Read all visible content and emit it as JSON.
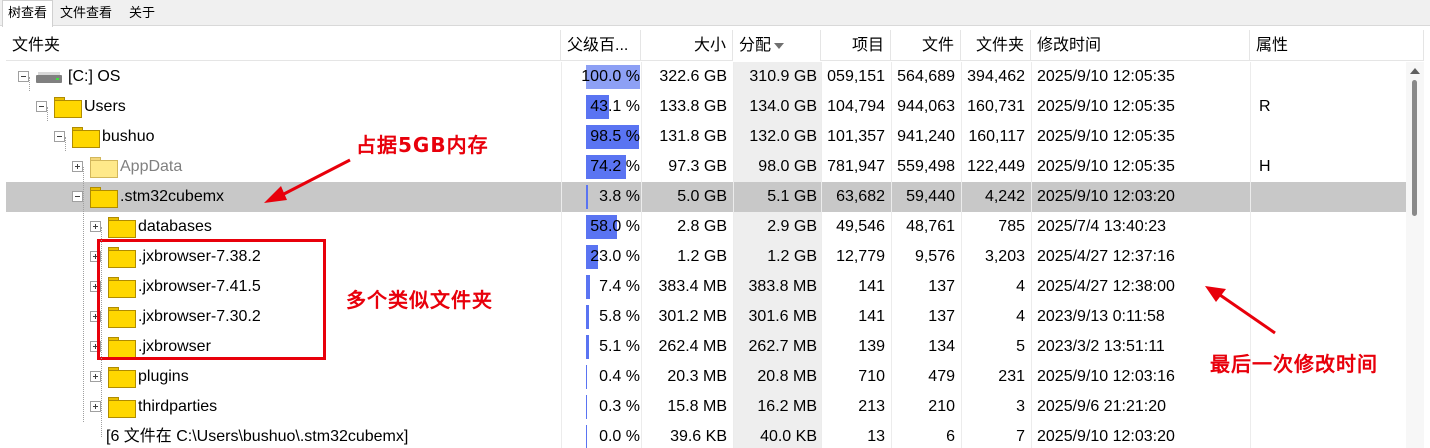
{
  "tabs": [
    "树查看",
    "文件查看",
    "关于"
  ],
  "columns": {
    "folder": "文件夹",
    "parent_pct": "父级百...",
    "size": "大小",
    "alloc": "分配",
    "items": "项目",
    "files": "文件",
    "folders": "文件夹",
    "modified": "修改时间",
    "attributes": "属性"
  },
  "rows": [
    {
      "name": "[C:] OS",
      "pct": "100.0 %",
      "pct_value": 100.0,
      "size": "322.6 GB",
      "alloc": "310.9 GB",
      "items": "059,151",
      "files": "564,689",
      "folders": "394,462",
      "modified": "2025/9/10 12:05:35",
      "attr": ""
    },
    {
      "name": "Users",
      "pct": "43.1 %",
      "pct_value": 43.1,
      "size": "133.8 GB",
      "alloc": "134.0 GB",
      "items": "104,794",
      "files": "944,063",
      "folders": "160,731",
      "modified": "2025/9/10 12:05:35",
      "attr": "R"
    },
    {
      "name": "bushuo",
      "pct": "98.5 %",
      "pct_value": 98.5,
      "size": "131.8 GB",
      "alloc": "132.0 GB",
      "items": "101,357",
      "files": "941,240",
      "folders": "160,117",
      "modified": "2025/9/10 12:05:35",
      "attr": ""
    },
    {
      "name": "AppData",
      "pct": "74.2 %",
      "pct_value": 74.2,
      "size": "97.3 GB",
      "alloc": "98.0 GB",
      "items": "781,947",
      "files": "559,498",
      "folders": "122,449",
      "modified": "2025/9/10 12:05:35",
      "attr": "H"
    },
    {
      "name": ".stm32cubemx",
      "pct": "3.8 %",
      "pct_value": 3.8,
      "size": "5.0 GB",
      "alloc": "5.1 GB",
      "items": "63,682",
      "files": "59,440",
      "folders": "4,242",
      "modified": "2025/9/10 12:03:20",
      "attr": ""
    },
    {
      "name": "databases",
      "pct": "58.0 %",
      "pct_value": 58.0,
      "size": "2.8 GB",
      "alloc": "2.9 GB",
      "items": "49,546",
      "files": "48,761",
      "folders": "785",
      "modified": "2025/7/4 13:40:23",
      "attr": ""
    },
    {
      "name": ".jxbrowser-7.38.2",
      "pct": "23.0 %",
      "pct_value": 23.0,
      "size": "1.2 GB",
      "alloc": "1.2 GB",
      "items": "12,779",
      "files": "9,576",
      "folders": "3,203",
      "modified": "2025/4/27 12:37:16",
      "attr": ""
    },
    {
      "name": ".jxbrowser-7.41.5",
      "pct": "7.4 %",
      "pct_value": 7.4,
      "size": "383.4 MB",
      "alloc": "383.8 MB",
      "items": "141",
      "files": "137",
      "folders": "4",
      "modified": "2025/4/27 12:38:00",
      "attr": ""
    },
    {
      "name": ".jxbrowser-7.30.2",
      "pct": "5.8 %",
      "pct_value": 5.8,
      "size": "301.2 MB",
      "alloc": "301.6 MB",
      "items": "141",
      "files": "137",
      "folders": "4",
      "modified": "2023/9/13 0:11:58",
      "attr": ""
    },
    {
      "name": ".jxbrowser",
      "pct": "5.1 %",
      "pct_value": 5.1,
      "size": "262.4 MB",
      "alloc": "262.7 MB",
      "items": "139",
      "files": "134",
      "folders": "5",
      "modified": "2023/3/2 13:51:11",
      "attr": ""
    },
    {
      "name": "plugins",
      "pct": "0.4 %",
      "pct_value": 0.4,
      "size": "20.3 MB",
      "alloc": "20.8 MB",
      "items": "710",
      "files": "479",
      "folders": "231",
      "modified": "2025/9/10 12:03:16",
      "attr": ""
    },
    {
      "name": "thirdparties",
      "pct": "0.3 %",
      "pct_value": 0.3,
      "size": "15.8 MB",
      "alloc": "16.2 MB",
      "items": "213",
      "files": "210",
      "folders": "3",
      "modified": "2025/9/6 21:21:20",
      "attr": ""
    },
    {
      "name": "[6 文件在 C:\\Users\\bushuo\\.stm32cubemx]",
      "pct": "0.0 %",
      "pct_value": 0.0,
      "size": "39.6 KB",
      "alloc": "40.0 KB",
      "items": "13",
      "files": "6",
      "folders": "7",
      "modified": "2025/9/10 12:03:20",
      "attr": ""
    }
  ],
  "annotations": {
    "memory": "占据5GB内存",
    "similar": "多个类似文件夹",
    "last_modified": "最后一次修改时间"
  },
  "colors": {
    "bar": "#5a74f2",
    "bar_light": "#8da0f5",
    "selected_row": "#c8c8c8",
    "annotation": "#e8000b",
    "folder": "#ffd700"
  },
  "icons": {
    "drive": "drive-icon",
    "folder": "folder-icon",
    "expand": "expander-icon",
    "sort": "sort-desc-icon"
  }
}
